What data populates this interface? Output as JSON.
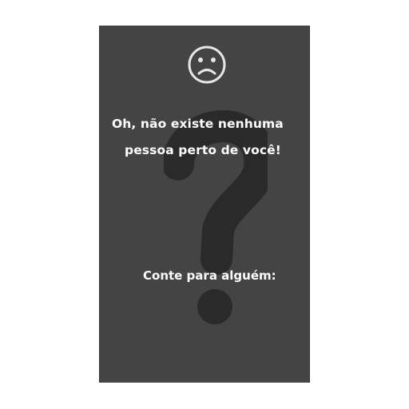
{
  "empty_state": {
    "icon": "sad-face-icon",
    "background_icon": "question-mark-icon",
    "message_line1": "Oh, não existe nenhuma",
    "message_line2": "pessoa perto de você!",
    "share_prompt": "Conte para alguém:"
  },
  "colors": {
    "screen_background": "#444444",
    "question_mark": "#2a2a2a",
    "text": "#ffffff",
    "icon": "#e6e6e6"
  }
}
